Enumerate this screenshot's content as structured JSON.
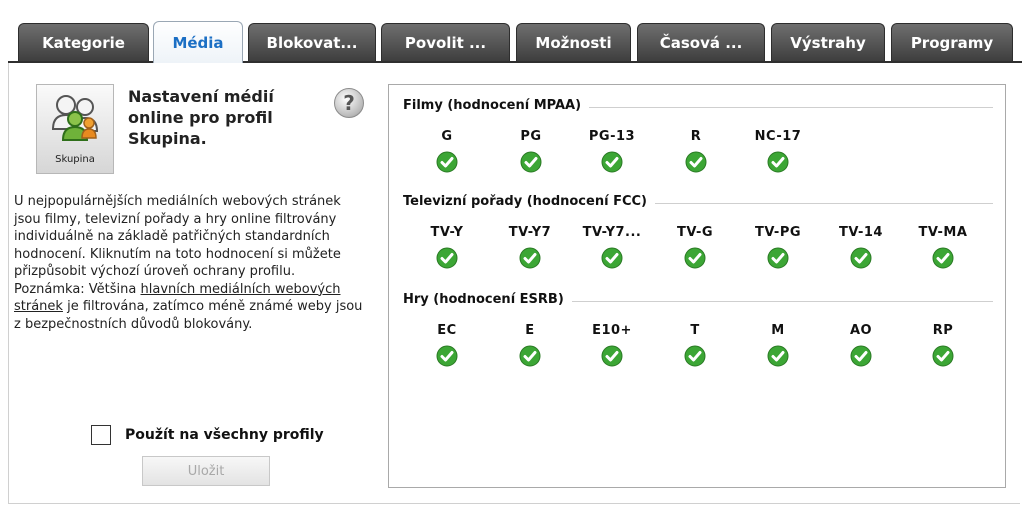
{
  "tabs": [
    {
      "label": "Kategorie",
      "active": false
    },
    {
      "label": "Média",
      "active": true
    },
    {
      "label": "Blokovat...",
      "active": false
    },
    {
      "label": "Povolit ...",
      "active": false
    },
    {
      "label": "Možnosti",
      "active": false
    },
    {
      "label": "Časová ...",
      "active": false
    },
    {
      "label": "Výstrahy",
      "active": false
    },
    {
      "label": "Programy",
      "active": false
    }
  ],
  "profile": {
    "avatar_label": "Skupina",
    "title": "Nastavení médií online pro profil Skupina.",
    "help_icon": "question-mark-icon",
    "description_1": "U nejpopulárnějších mediálních webových stránek jsou filmy, televizní pořady a hry online filtrovány individuálně na základě patřičných standardních hodnocení. Kliknutím na toto hodnocení si můžete přizpůsobit výchozí úroveň ochrany profilu. Poznámka: Většina ",
    "description_link": "hlavních mediálních webových stránek",
    "description_2": " je filtrována, zatímco méně známé weby jsou z bezpečnostních důvodů blokovány."
  },
  "apply_all": {
    "label": "Použít na všechny profily",
    "checked": false
  },
  "save_label": "Uložit",
  "sections": [
    {
      "title": "Filmy (hodnocení MPAA)",
      "ratings": [
        "G",
        "PG",
        "PG-13",
        "R",
        "NC-17"
      ]
    },
    {
      "title": "Televizní pořady (hodnocení FCC)",
      "ratings": [
        "TV-Y",
        "TV-Y7",
        "TV-Y7...",
        "TV-G",
        "TV-PG",
        "TV-14",
        "TV-MA"
      ]
    },
    {
      "title": "Hry (hodnocení ESRB)",
      "ratings": [
        "EC",
        "E",
        "E10+",
        "T",
        "M",
        "AO",
        "RP"
      ]
    }
  ],
  "colors": {
    "check_green": "#3ca635",
    "active_tab_text": "#1c6fc4"
  }
}
